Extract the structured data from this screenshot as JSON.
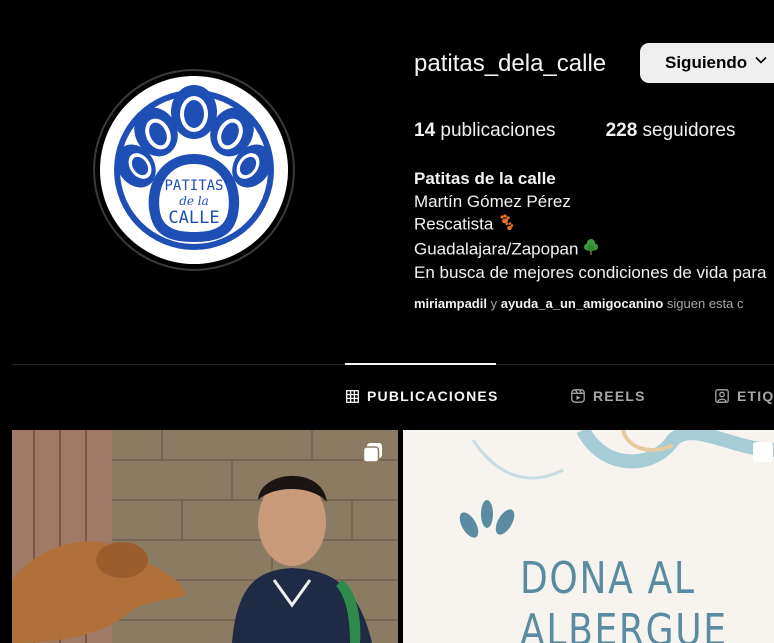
{
  "profile": {
    "username": "patitas_dela_calle",
    "follow_button_label": "Siguiendo",
    "avatar_logo_text": [
      "PATITAS",
      "de la",
      "CALLE"
    ]
  },
  "stats": {
    "posts_count": "14",
    "posts_label": "publicaciones",
    "followers_count": "228",
    "followers_label": "seguidores"
  },
  "bio": {
    "name": "Patitas de la calle",
    "line1": "Martín Gómez Pérez",
    "line2": "Rescatista",
    "line2_emoji": "paw-prints-icon",
    "line3": "Guadalajara/Zapopan",
    "line3_emoji": "tree-icon",
    "line4": "En busca de mejores condiciones de vida para"
  },
  "followed_by": {
    "user1": "miriampadil",
    "connector": "y",
    "user2": "ayuda_a_un_amigocanino",
    "suffix": "siguen esta c"
  },
  "tabs": [
    {
      "label": "PUBLICACIONES",
      "icon": "grid-icon",
      "active": true
    },
    {
      "label": "REELS",
      "icon": "reels-icon",
      "active": false
    },
    {
      "label": "ETIQ",
      "icon": "tagged-icon",
      "active": false
    }
  ],
  "posts": [
    {
      "type": "photo",
      "multi": true
    },
    {
      "type": "graphic",
      "text_lines": [
        "DONA AL",
        "ALBERGUE"
      ]
    }
  ],
  "colors": {
    "background": "#000000",
    "logo_blue": "#1f4fb5",
    "poster_text": "#5a8ba0"
  }
}
